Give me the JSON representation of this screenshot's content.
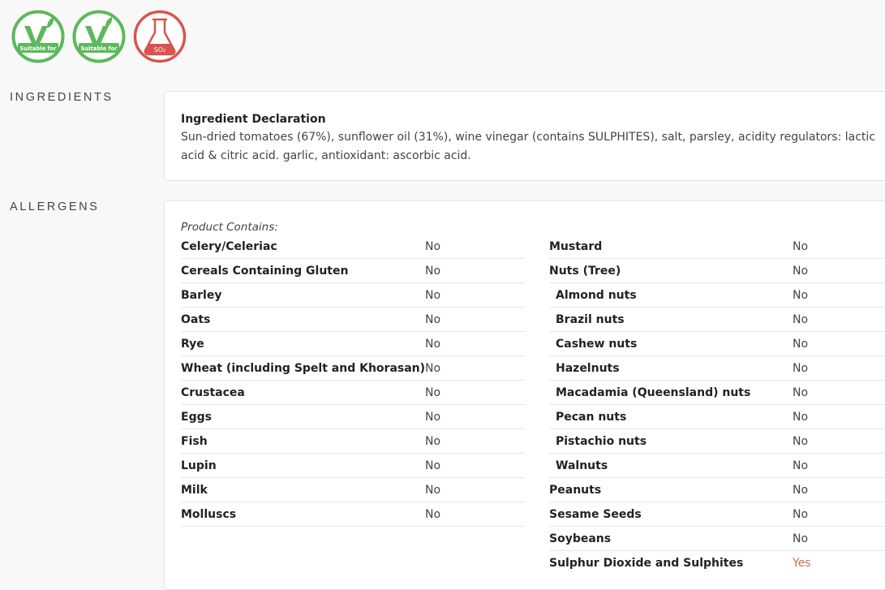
{
  "badges": [
    {
      "icon": "vegetarian-icon",
      "caption": "Suitable for",
      "color": "#5cb85c"
    },
    {
      "icon": "vegan-icon",
      "caption": "Suitable for",
      "color": "#5cb85c"
    },
    {
      "icon": "sulphites-flask-icon",
      "caption": "SO₂",
      "color": "#d9534f"
    }
  ],
  "sections": {
    "ingredients_label": "INGREDIENTS",
    "allergens_label": "ALLERGENS"
  },
  "ingredients": {
    "title": "Ingredient Declaration",
    "text": "Sun-dried tomatoes (67%), sunflower oil (31%), wine vinegar (contains SULPHITES), salt, parsley, acidity regulators: lactic acid & citric acid. garlic, antioxidant: ascorbic acid."
  },
  "allergens": {
    "contains_label": "Product Contains:",
    "left": [
      {
        "name": "Celery/Celeriac",
        "value": "No"
      },
      {
        "name": "Cereals Containing Gluten",
        "value": "No"
      },
      {
        "name": "Barley",
        "value": "No"
      },
      {
        "name": "Oats",
        "value": "No"
      },
      {
        "name": "Rye",
        "value": "No"
      },
      {
        "name": "Wheat (including Spelt and Khorasan)",
        "value": "No"
      },
      {
        "name": "Crustacea",
        "value": "No"
      },
      {
        "name": "Eggs",
        "value": "No"
      },
      {
        "name": "Fish",
        "value": "No"
      },
      {
        "name": "Lupin",
        "value": "No"
      },
      {
        "name": "Milk",
        "value": "No"
      },
      {
        "name": "Molluscs",
        "value": "No"
      }
    ],
    "right": [
      {
        "name": "Mustard",
        "value": "No"
      },
      {
        "name": "Nuts (Tree)",
        "value": "No"
      },
      {
        "name": "Almond nuts",
        "value": "No",
        "sub": true
      },
      {
        "name": "Brazil nuts",
        "value": "No",
        "sub": true
      },
      {
        "name": "Cashew nuts",
        "value": "No",
        "sub": true
      },
      {
        "name": "Hazelnuts",
        "value": "No",
        "sub": true
      },
      {
        "name": "Macadamia (Queensland) nuts",
        "value": "No",
        "sub": true
      },
      {
        "name": "Pecan nuts",
        "value": "No",
        "sub": true
      },
      {
        "name": "Pistachio nuts",
        "value": "No",
        "sub": true
      },
      {
        "name": "Walnuts",
        "value": "No",
        "sub": true
      },
      {
        "name": "Peanuts",
        "value": "No"
      },
      {
        "name": "Sesame Seeds",
        "value": "No"
      },
      {
        "name": "Soybeans",
        "value": "No"
      },
      {
        "name": "Sulphur Dioxide and Sulphites",
        "value": "Yes"
      }
    ]
  }
}
